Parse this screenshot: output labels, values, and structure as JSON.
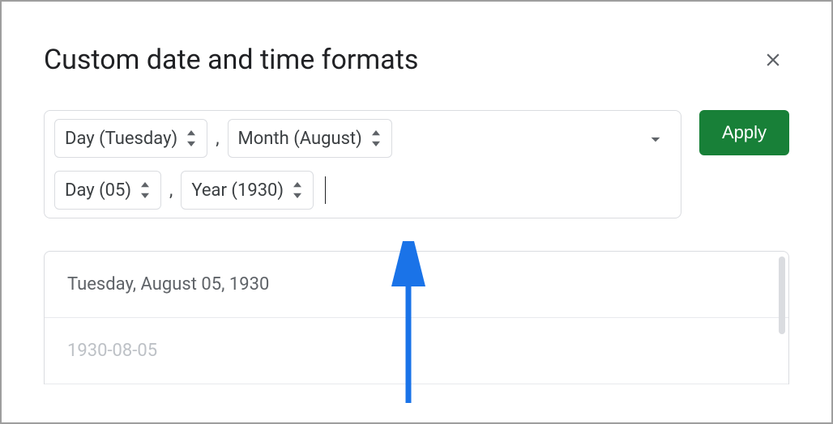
{
  "dialog": {
    "title": "Custom date and time formats",
    "apply_label": "Apply"
  },
  "format_tokens": [
    {
      "label": "Day (Tuesday)",
      "name": "token-day-name"
    },
    {
      "sep": ","
    },
    {
      "label": "Month (August)",
      "name": "token-month-name"
    },
    {
      "break": true
    },
    {
      "label": "Day (05)",
      "name": "token-day-number"
    },
    {
      "sep": ","
    },
    {
      "label": "Year (1930)",
      "name": "token-year"
    }
  ],
  "presets": [
    "Tuesday, August 05, 1930",
    "1930-08-05"
  ]
}
